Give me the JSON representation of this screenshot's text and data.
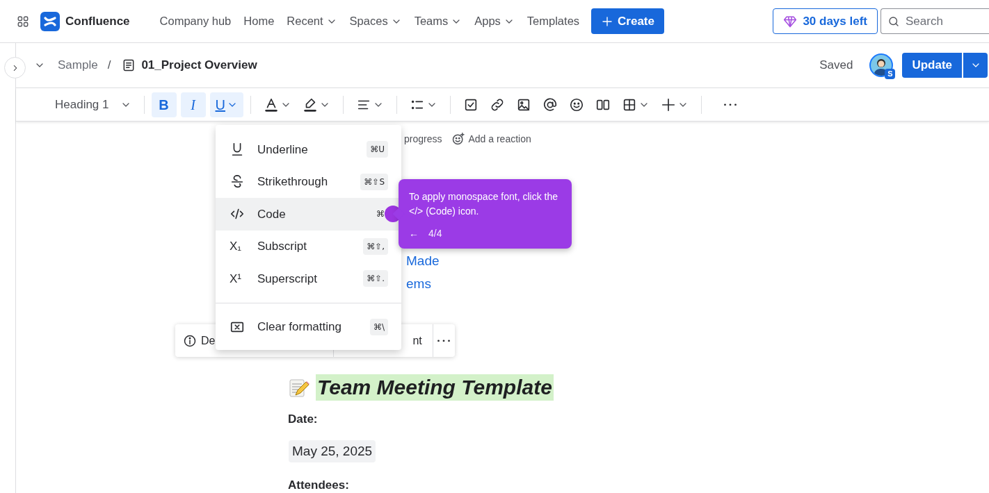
{
  "nav": {
    "product": "Confluence",
    "items": [
      {
        "label": "Company hub",
        "dropdown": false
      },
      {
        "label": "Home",
        "dropdown": false
      },
      {
        "label": "Recent",
        "dropdown": true
      },
      {
        "label": "Spaces",
        "dropdown": true
      },
      {
        "label": "Teams",
        "dropdown": true
      },
      {
        "label": "Apps",
        "dropdown": true
      },
      {
        "label": "Templates",
        "dropdown": false
      }
    ],
    "create": "Create",
    "trial": "30 days left",
    "search": {
      "placeholder": "Search"
    }
  },
  "page_header": {
    "breadcrumb": [
      "Sample",
      "01_Project Overview"
    ],
    "breadcrumb_separator": "/",
    "status": "Saved",
    "avatar_badge": "S",
    "update": "Update"
  },
  "toolbar": {
    "heading_style": "Heading 1",
    "format_buttons": [
      {
        "kind": "bold",
        "label": "B",
        "selected": true,
        "dropdown": false
      },
      {
        "kind": "italic",
        "label": "I",
        "selected": true,
        "dropdown": false
      },
      {
        "kind": "underline",
        "label": "U",
        "selected": true,
        "dropdown": true
      }
    ],
    "tools": [
      {
        "kind": "text-color",
        "dropdown": true,
        "divider_before": true
      },
      {
        "kind": "highlight",
        "dropdown": true
      },
      {
        "kind": "align",
        "dropdown": true,
        "divider_before": true
      },
      {
        "kind": "list",
        "dropdown": true,
        "divider_before": true
      },
      {
        "kind": "task",
        "divider_before": true
      },
      {
        "kind": "link"
      },
      {
        "kind": "image"
      },
      {
        "kind": "mention"
      },
      {
        "kind": "emoji"
      },
      {
        "kind": "layout"
      },
      {
        "kind": "table",
        "dropdown": true
      },
      {
        "kind": "insert",
        "dropdown": true
      },
      {
        "kind": "more",
        "divider_before": true
      }
    ]
  },
  "content": {
    "meta": [
      "progress",
      "Add a reaction"
    ],
    "links": [
      "Made",
      "ems"
    ],
    "floating_toolbar": [
      "De",
      "nt"
    ],
    "heading": "Team Meeting Template",
    "date_label": "Date:",
    "date": "May 25, 2025",
    "attendees_label": "Attendees:"
  },
  "format_menu": {
    "items": [
      {
        "kind": "underline",
        "label": "Underline",
        "shortcut": "⌘U",
        "selected": false
      },
      {
        "kind": "strikethrough",
        "label": "Strikethrough",
        "shortcut": "⌘⇧S",
        "selected": false
      },
      {
        "kind": "code",
        "label": "Code",
        "shortcut": "⌘",
        "selected": true
      },
      {
        "kind": "subscript",
        "icon_text": "X₁",
        "label": "Subscript",
        "shortcut": "⌘⇧,",
        "selected": false
      },
      {
        "kind": "superscript",
        "icon_text": "X¹",
        "label": "Superscript",
        "shortcut": "⌘⇧.",
        "selected": false
      }
    ],
    "footer_items": [
      {
        "kind": "clear",
        "label": "Clear formatting",
        "shortcut": "⌘\\",
        "selected": false
      }
    ]
  },
  "tooltip": {
    "text": "To apply monospace font, click the </> (Code) icon.",
    "back": "←",
    "step": "4/4"
  }
}
